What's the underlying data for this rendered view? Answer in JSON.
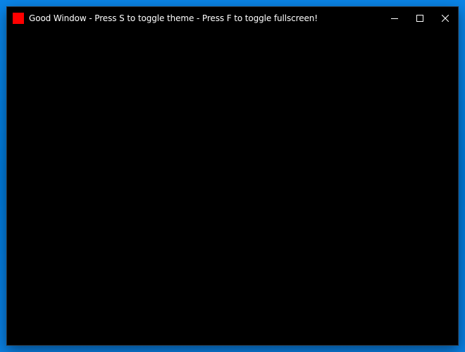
{
  "window": {
    "title": "Good Window - Press S to toggle theme - Press F to toggle fullscreen!",
    "app_icon": {
      "name": "app-icon",
      "color": "#ff0000"
    },
    "caption_buttons": {
      "minimize": "minimize-icon",
      "maximize": "maximize-icon",
      "close": "close-icon"
    },
    "client_background": "#000000"
  },
  "desktop": {
    "background_color": "#0078d7"
  }
}
